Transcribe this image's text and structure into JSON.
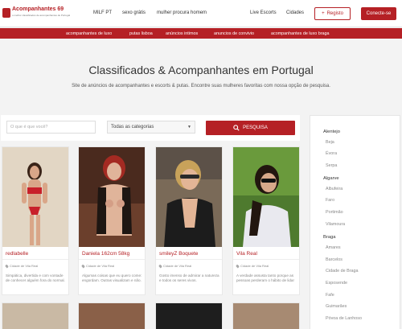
{
  "header": {
    "logo_text": "Acompanhantes 69",
    "logo_sub": "o melhor classificados de acompanhantes de Portugal",
    "nav": [
      "MILF PT",
      "sexo grátis",
      "mulher procura homem",
      "Live Escorts",
      "Cidades"
    ],
    "register_label": "Registo",
    "login_label": "Conecte-se"
  },
  "categories": [
    "acompanhantes de luxo",
    "putas lisboa",
    "anúncios intimos",
    "anuncios de convivio",
    "acompanhantes de luxo braga"
  ],
  "hero": {
    "title": "Classificados & Acompanhantes em Portugal",
    "subtitle": "Site de anúncios de acompanhantes e escorts & putas. Encontre suas mulheres favoritas com nossa opção de pesquisa."
  },
  "search": {
    "placeholder": "O que é que você?",
    "category_value": "Todas as categorias",
    "button_label": "PESQUISA"
  },
  "colors": {
    "accent": "#b52025",
    "background": "#f3f3f3"
  },
  "listings": [
    {
      "title": "redlabelle",
      "location": "Cidade de Vila Real",
      "description": "Simpática, divertida e com vontade de conhecer alguém fora do normal."
    },
    {
      "title": "Daniela 162cm 58kg",
      "location": "Cidade de Vila Real",
      "description": "Algumas coisas que eu quero come: engordam. Outras visualizam e não."
    },
    {
      "title": "smileyZ Boquete",
      "location": "Cidade de Vila Real",
      "description": "Gosto imenso de admirar a natureza e todos os seres vivos."
    },
    {
      "title": "Vila Real",
      "location": "Cidade de Vila Real",
      "description": "A verdade assusta tanto porque as pessoas perderam o hábito de lidar"
    }
  ],
  "sidebar": {
    "groups": [
      {
        "region": "Alentejo",
        "cities": [
          "Beja",
          "Évora",
          "Serpa"
        ]
      },
      {
        "region": "Algarve",
        "cities": [
          "Albufeira",
          "Faro",
          "Portimão",
          "Vilamoura"
        ]
      },
      {
        "region": "Braga",
        "cities": [
          "Amares",
          "Barcelos",
          "Cidade de Braga",
          "Esposende",
          "Fafe",
          "Guimarães",
          "Póvoa de Lanhoso"
        ]
      }
    ]
  }
}
